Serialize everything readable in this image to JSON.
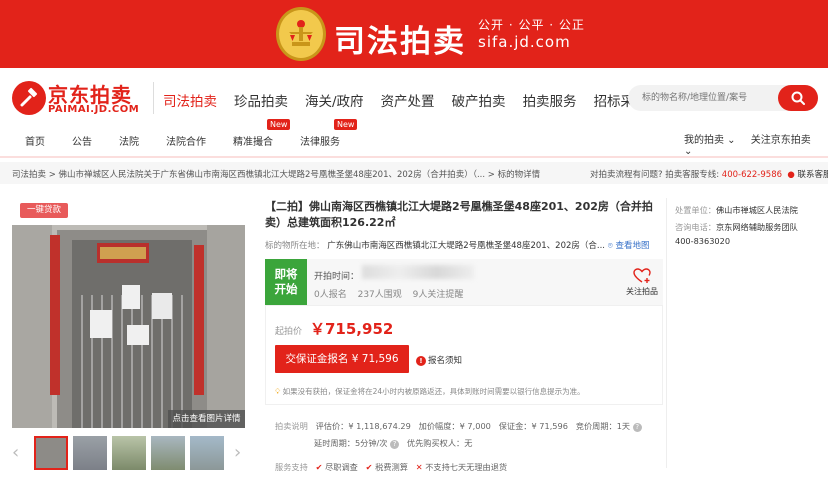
{
  "banner": {
    "title": "司法拍卖",
    "slogan": "公开 · 公平 · 公正",
    "domain": "sifa.jd.com"
  },
  "logo": {
    "cn": "京东拍卖",
    "en": "PAIMAI.JD.COM"
  },
  "nav": {
    "items": [
      "司法拍卖",
      "珍品拍卖",
      "海关/政府",
      "资产处置",
      "破产拍卖",
      "拍卖服务",
      "招标采购"
    ],
    "active_index": 0
  },
  "search": {
    "placeholder": "标的物名称/地理位置/案号"
  },
  "subnav": {
    "items": [
      {
        "label": "首页",
        "tag": ""
      },
      {
        "label": "公告",
        "tag": ""
      },
      {
        "label": "法院",
        "tag": ""
      },
      {
        "label": "法院合作",
        "tag": ""
      },
      {
        "label": "精准撮合",
        "tag": "New"
      },
      {
        "label": "法律服务",
        "tag": "New"
      }
    ],
    "my_auction": "我的拍卖 ⌄",
    "follow_jd": "关注京东拍卖 ⌄"
  },
  "breadcrumb": {
    "path": "司法拍卖  >  佛山市禅城区人民法院关于广东省佛山市南海区西樵镇北江大堤路2号凰樵圣堡48座201、202房（合并拍卖）（...  >  标的物详情",
    "question": "对拍卖流程有问题?  拍卖客服专线:",
    "phone": "400-622-9586",
    "service": "联系客服"
  },
  "gallery": {
    "loan_tag": "一键贷款",
    "detail_button": "点击查看图片详情",
    "prev": "‹",
    "next": "›"
  },
  "item": {
    "title": "【二拍】佛山南海区西樵镇北江大堤路2号凰樵圣堡48座201、202房（合并拍卖）总建筑面积126.22㎡",
    "address_label": "标的物所在地：",
    "address": "广东佛山市南海区西樵镇北江大堤路2号凰樵圣堡48座201、202房（合...",
    "map_link": "查看地图",
    "status_line1": "即将",
    "status_line2": "开始",
    "start_time_label": "开拍时间：",
    "bidders": "0人报名",
    "viewers": "237人围观",
    "reminders": "9人关注提醒",
    "follow_label": "关注拍品",
    "start_price_label": "起拍价",
    "start_price": "￥715,952",
    "deposit_button": "交保证金报名 ¥ 71,596",
    "notice_label": "报名须知",
    "notice_text": "如果没有获拍，保证金将在24小时内被原路返还，具体到账时间需要以银行信息提示为准。"
  },
  "details": {
    "section_label": "拍卖说明",
    "assessed_label": "评估价：",
    "assessed": "¥ 1,118,674.29",
    "increment_label": "加价幅度：",
    "increment": "¥ 7,000",
    "deposit_label": "保证金：",
    "deposit": "¥ 71,596",
    "period_label": "竞价周期：",
    "period": "1天",
    "delay_label": "延时周期：",
    "delay": "5分钟/次",
    "priority_label": "优先购买权人：",
    "priority": "无"
  },
  "service": {
    "label": "服务支持",
    "items": [
      "尽职调查",
      "税费测算"
    ],
    "no_return": "不支持七天无理由退货"
  },
  "side": {
    "unit_label": "处置单位：",
    "unit": "佛山市禅城区人民法院",
    "contact_label": "咨询电话：",
    "contact": "京东网络辅助服务团队",
    "phone": "400-8363020"
  },
  "colors": {
    "brand": "#e2231a",
    "status_green": "#3ba53b"
  }
}
